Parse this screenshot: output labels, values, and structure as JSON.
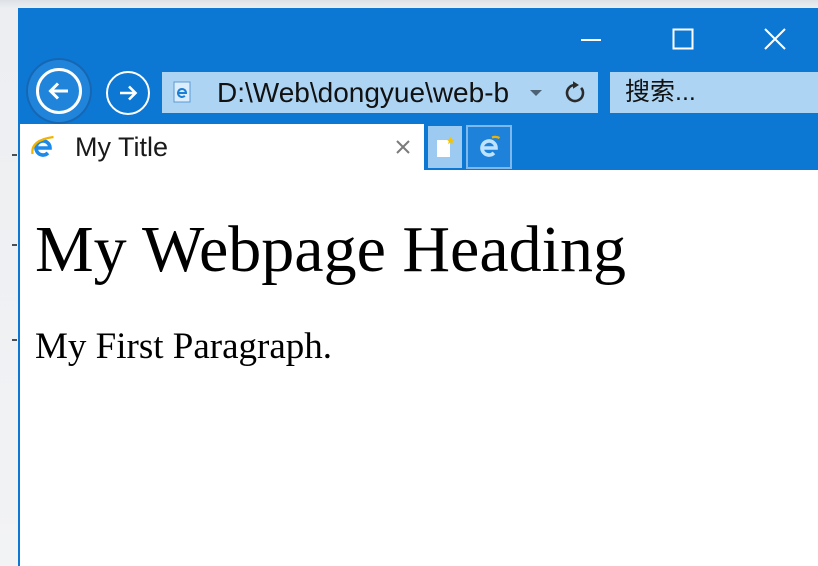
{
  "window_controls": {
    "minimize_icon": "minimize-icon",
    "maximize_icon": "maximize-icon",
    "close_icon": "close-icon"
  },
  "navigation": {
    "back_icon": "back-arrow-icon",
    "forward_icon": "forward-arrow-icon",
    "address_bar": {
      "site_icon": "ie-page-icon",
      "value": "D:\\Web\\dongyue\\web-b",
      "dropdown_icon": "chevron-down-icon",
      "refresh_icon": "refresh-icon"
    },
    "search": {
      "placeholder": "搜索..."
    }
  },
  "tabs": [
    {
      "title": "My Title",
      "icon": "internet-explorer-icon",
      "close_icon": "close-icon",
      "active": true
    }
  ],
  "tab_bar_buttons": {
    "new_tab_icon": "new-tab-icon",
    "edge_icon": "microsoft-edge-icon"
  },
  "page": {
    "heading": "My Webpage Heading",
    "paragraph": "My First Paragraph."
  },
  "colors": {
    "accent": "#0c78d4",
    "address_bar": "#aed4f4",
    "page_background": "#ffffff",
    "page_text": "#000000"
  }
}
